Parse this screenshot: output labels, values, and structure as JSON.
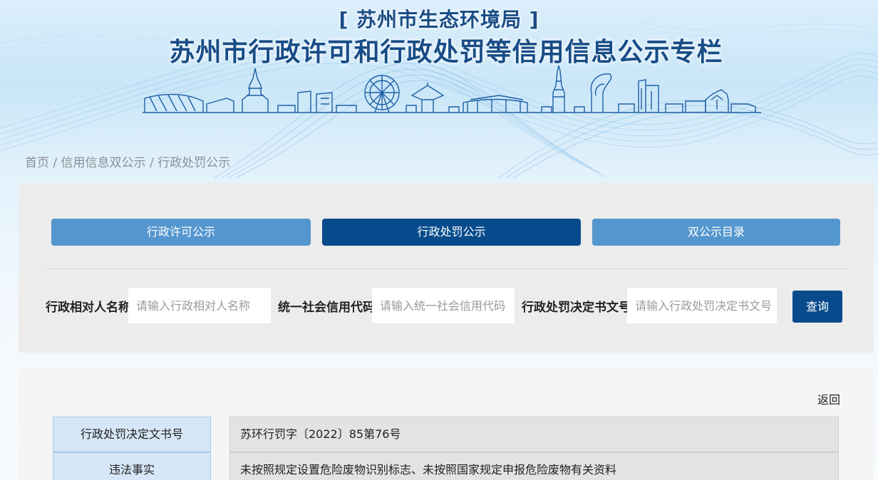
{
  "header": {
    "agency": "[ 苏州市生态环境局 ]",
    "title": "苏州市行政许可和行政处罚等信用信息公示专栏"
  },
  "breadcrumb": {
    "home": "首页",
    "sep": " / ",
    "level2": "信用信息双公示",
    "current": "行政处罚公示"
  },
  "tabs": [
    {
      "label": "行政许可公示",
      "active": false
    },
    {
      "label": "行政处罚公示",
      "active": true
    },
    {
      "label": "双公示目录",
      "active": false
    }
  ],
  "search": {
    "name_label": "行政相对人名称",
    "name_placeholder": "请输入行政相对人名称",
    "code_label": "统一社会信用代码",
    "code_placeholder": "请输入统一社会信用代码",
    "doc_label": "行政处罚决定书文号",
    "doc_placeholder": "请输入行政处罚决定书文号",
    "query_button": "查询"
  },
  "detail": {
    "back": "返回",
    "rows": [
      {
        "label": "行政处罚决定文书号",
        "value": "苏环行罚字〔2022〕85第76号"
      },
      {
        "label": "违法事实",
        "value": "未按照规定设置危险废物识别标志、未按照国家规定申报危险废物有关资料"
      }
    ]
  },
  "colors": {
    "tab_light": "#5496ce",
    "tab_dark": "#084b8c",
    "title_blue": "#184c86"
  }
}
